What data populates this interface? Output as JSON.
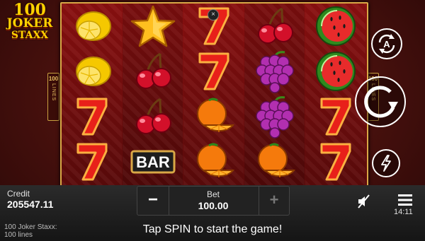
{
  "logo": {
    "number": "100",
    "word1": "JOKER",
    "word2": "STAXX"
  },
  "lines_indicator": {
    "count": "100",
    "label": "LINES"
  },
  "reels": [
    [
      "lemon",
      "lemon",
      "seven",
      "seven"
    ],
    [
      "star",
      "cherry",
      "cherry",
      "bar"
    ],
    [
      "seven",
      "seven",
      "orange",
      "orange"
    ],
    [
      "cherry",
      "grapes",
      "grapes",
      "orange"
    ],
    [
      "watermelon",
      "watermelon",
      "seven",
      "seven"
    ]
  ],
  "bar_symbol_text": "BAR",
  "close_glyph": "×",
  "controls": {
    "autoplay_letter": "A",
    "autoplay_icon": "autoplay-icon",
    "spin_icon": "spin-arrow-icon",
    "turbo_icon": "lightning-icon"
  },
  "credit": {
    "label": "Credit",
    "value": "205547.11"
  },
  "bet": {
    "label": "Bet",
    "value": "100.00",
    "minus": "−",
    "plus": "+"
  },
  "clock": "14:11",
  "game_name": {
    "line1": "100 Joker Staxx:",
    "line2": "100 lines"
  },
  "hint": "Tap SPIN to start the game!",
  "colors": {
    "accent_gold": "#ffd200",
    "frame_gold": "#d9a846",
    "reel_red": "#8a1010",
    "background": "#46100d"
  }
}
